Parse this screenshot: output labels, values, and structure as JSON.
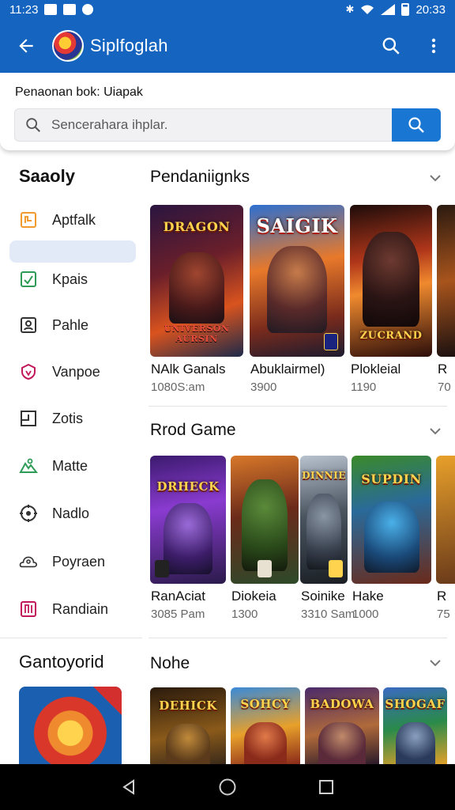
{
  "status_bar": {
    "time": "11:23",
    "right_time": "20:33"
  },
  "app_bar": {
    "title": "Siplfoglah"
  },
  "search": {
    "heading": "Penaonan bok: Uiapak",
    "placeholder": "Sencerahara ihplar."
  },
  "sidebar": {
    "title": "Saaoly",
    "items": [
      {
        "label": "Aptfalk",
        "icon": "app-grid-icon",
        "color": "#f29a2e"
      },
      {
        "label": "",
        "icon": "",
        "color": ""
      },
      {
        "label": "Kpais",
        "icon": "check-box-icon",
        "color": "#2e9b56"
      },
      {
        "label": "Pahle",
        "icon": "person-box-icon",
        "color": "#333333"
      },
      {
        "label": "Vanpoe",
        "icon": "shield-icon",
        "color": "#c2185b"
      },
      {
        "label": "Zotis",
        "icon": "window-icon",
        "color": "#333333"
      },
      {
        "label": "Matte",
        "icon": "mountain-icon",
        "color": "#2e9b56"
      },
      {
        "label": "Nadlo",
        "icon": "settings-ring-icon",
        "color": "#333333"
      },
      {
        "label": "Poyraen",
        "icon": "cloud-person-icon",
        "color": "#333333"
      },
      {
        "label": "Randiain",
        "icon": "book-icon",
        "color": "#c2185b"
      }
    ]
  },
  "sections": [
    {
      "title": "Pendaniignks",
      "cards": [
        {
          "name": "NAlk Ganals",
          "sub": "1080S:am",
          "art": "DRAGON",
          "art_bottom": "UNIVERSON AURSIN"
        },
        {
          "name": "Abuklairmel)",
          "sub": "3900",
          "art": "SAIGIK",
          "art_bottom": ""
        },
        {
          "name": "Plokleial",
          "sub": "1190",
          "art": "",
          "art_bottom": "ZUCRAND"
        },
        {
          "name": "R",
          "sub": "70",
          "art": "",
          "art_bottom": ""
        }
      ]
    },
    {
      "title": "Rrod Game",
      "cards": [
        {
          "name": "RanAciat",
          "sub": "3085 Pam",
          "art": "DRHECK"
        },
        {
          "name": "Diokeia",
          "sub": "1300",
          "art": ""
        },
        {
          "name": "Soinike",
          "sub": "3310 Sam",
          "art": "DINNIE"
        },
        {
          "name": "Hake",
          "sub": "1000",
          "art": "SUPDIN"
        },
        {
          "name": "R",
          "sub": "75",
          "art": ""
        }
      ]
    },
    {
      "title": "Nohe",
      "cards": [
        {
          "name": "",
          "sub": "",
          "art": "DEHICK"
        },
        {
          "name": "",
          "sub": "",
          "art": "SOHCY"
        },
        {
          "name": "",
          "sub": "",
          "art": "BADOWA"
        },
        {
          "name": "",
          "sub": "",
          "art": "SHOGAF"
        }
      ]
    }
  ],
  "bottom_left": {
    "title": "Gantoyorid"
  }
}
